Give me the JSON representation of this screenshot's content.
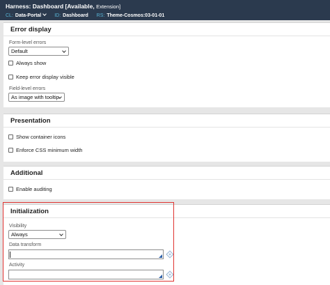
{
  "header": {
    "title": "Harness: Dashboard [Available,",
    "title_suffix": "Extension]",
    "cl_key": "CL:",
    "cl_value": "Data-Portal",
    "id_key": "ID:",
    "id_value": "Dashboard",
    "rs_key": "RS:",
    "rs_value": "Theme-Cosmos:03-01-01"
  },
  "error_display": {
    "title": "Error display",
    "form_level_label": "Form-level errors",
    "form_level_value": "Default",
    "always_show": "Always show",
    "keep_visible": "Keep error display visible",
    "field_level_label": "Field-level errors",
    "field_level_value": "As image with tooltip"
  },
  "presentation": {
    "title": "Presentation",
    "show_container_icons": "Show container icons",
    "enforce_css": "Enforce CSS minimum width"
  },
  "additional": {
    "title": "Additional",
    "enable_auditing": "Enable auditing"
  },
  "initialization": {
    "title": "Initialization",
    "visibility_label": "Visibility",
    "visibility_value": "Always",
    "data_transform_label": "Data transform",
    "data_transform_value": "",
    "activity_label": "Activity",
    "activity_value": ""
  },
  "colors": {
    "header_bg": "#2b3a4e",
    "header_key": "#58b5d6",
    "highlight": "#e0322f"
  }
}
